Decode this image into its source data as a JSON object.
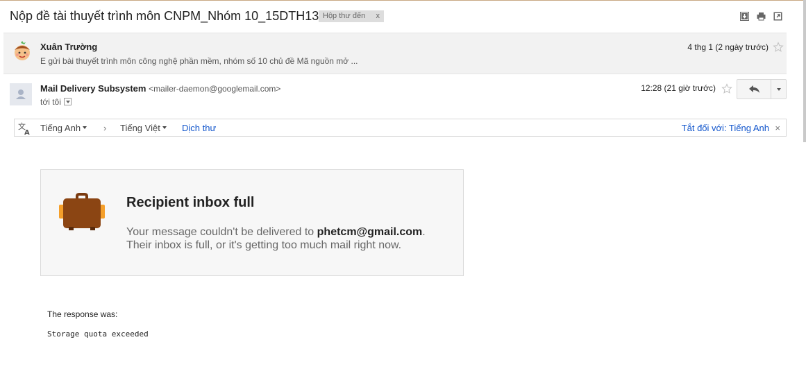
{
  "subject": "Nộp đề tài thuyết trình môn CNPM_Nhóm 10_15DTH13",
  "label": {
    "text": "Hộp thư đến",
    "close": "x"
  },
  "toolbar_icons": [
    "download-icon",
    "print-icon",
    "new-window-icon"
  ],
  "message1": {
    "sender": "Xuân Trường",
    "snippet": "E gửi bài thuyết trình môn công nghệ phần mềm, nhóm số 10 chủ đề Mã nguồn mở ...",
    "date": "4 thg 1 (2 ngày trước)"
  },
  "message2": {
    "sender": "Mail Delivery Subsystem",
    "email": "<mailer-daemon@googlemail.com>",
    "to": "tới tôi",
    "date": "12:28 (21 giờ trước)"
  },
  "translate": {
    "from_lang": "Tiếng Anh",
    "arrow": "›",
    "to_lang": "Tiếng Việt",
    "action": "Dịch thư",
    "off_for": "Tắt đối với: Tiếng Anh",
    "close": "×"
  },
  "bounce": {
    "title": "Recipient inbox full",
    "line1_prefix": "Your message couldn't be delivered to ",
    "address": "phetcm@gmail.com",
    "line1_suffix": ".",
    "line2": "Their inbox is full, or it's getting too much mail right now."
  },
  "response": {
    "label": "The response was:",
    "code": "Storage quota exceeded"
  },
  "colors": {
    "link": "#1155cc",
    "bag": "#8b4513",
    "bag_accent": "#f59f2a"
  }
}
